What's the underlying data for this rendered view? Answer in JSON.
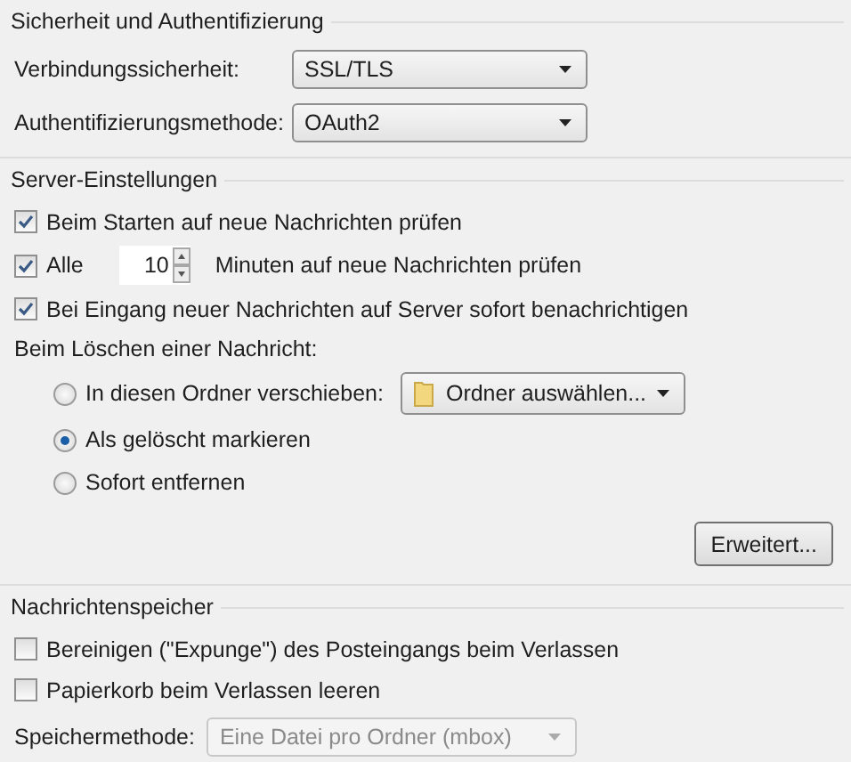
{
  "sections": [
    {
      "title": "Sicherheit und Authentifizierung",
      "items": [
        {
          "kind": "select",
          "label": "Verbindungssicherheit:",
          "value": "SSL/TLS",
          "disabled": false
        },
        {
          "kind": "select",
          "label": "Authentifizierungsmethode:",
          "value": "OAuth2",
          "disabled": false
        }
      ]
    },
    {
      "title": "Server-Einstellungen",
      "items": [
        {
          "kind": "checkbox",
          "label": "Beim Starten auf neue Nachrichten prüfen",
          "checked": true
        },
        {
          "kind": "interval",
          "label": "Alle",
          "value": "10",
          "suffix": "Minuten auf neue Nachrichten prüfen",
          "checked": true
        },
        {
          "kind": "checkbox",
          "label": "Bei Eingang neuer Nachrichten auf Server sofort benachrichtigen",
          "checked": true
        },
        {
          "kind": "label",
          "label": "Beim Löschen einer Nachricht:"
        },
        {
          "kind": "radio",
          "label": "In diesen Ordner verschieben:",
          "selected": false,
          "folder": "Ordner auswählen..."
        },
        {
          "kind": "radio",
          "label": "Als gelöscht markieren",
          "selected": true
        },
        {
          "kind": "radio",
          "label": "Sofort entfernen",
          "selected": false
        },
        {
          "kind": "button",
          "label": "Erweitert..."
        }
      ]
    },
    {
      "title": "Nachrichtenspeicher",
      "items": [
        {
          "kind": "checkbox",
          "label": "Bereinigen (\"Expunge\") des Posteingangs beim Verlassen",
          "checked": false
        },
        {
          "kind": "checkbox",
          "label": "Papierkorb beim Verlassen leeren",
          "checked": false
        },
        {
          "kind": "select",
          "label": "Speichermethode:",
          "value": "Eine Datei pro Ordner (mbox)",
          "disabled": true
        }
      ]
    }
  ]
}
